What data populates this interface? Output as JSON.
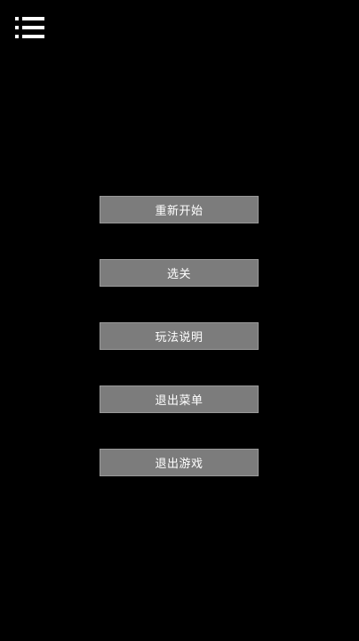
{
  "header": {
    "menu_icon": "hamburger-list-icon"
  },
  "menu": {
    "items": [
      {
        "label": "重新开始"
      },
      {
        "label": "选关"
      },
      {
        "label": "玩法说明"
      },
      {
        "label": "退出菜单"
      },
      {
        "label": "退出游戏"
      }
    ]
  },
  "colors": {
    "background": "#000000",
    "button_bg": "#7c7c7c",
    "button_text": "#ffffff",
    "icon": "#ffffff"
  }
}
